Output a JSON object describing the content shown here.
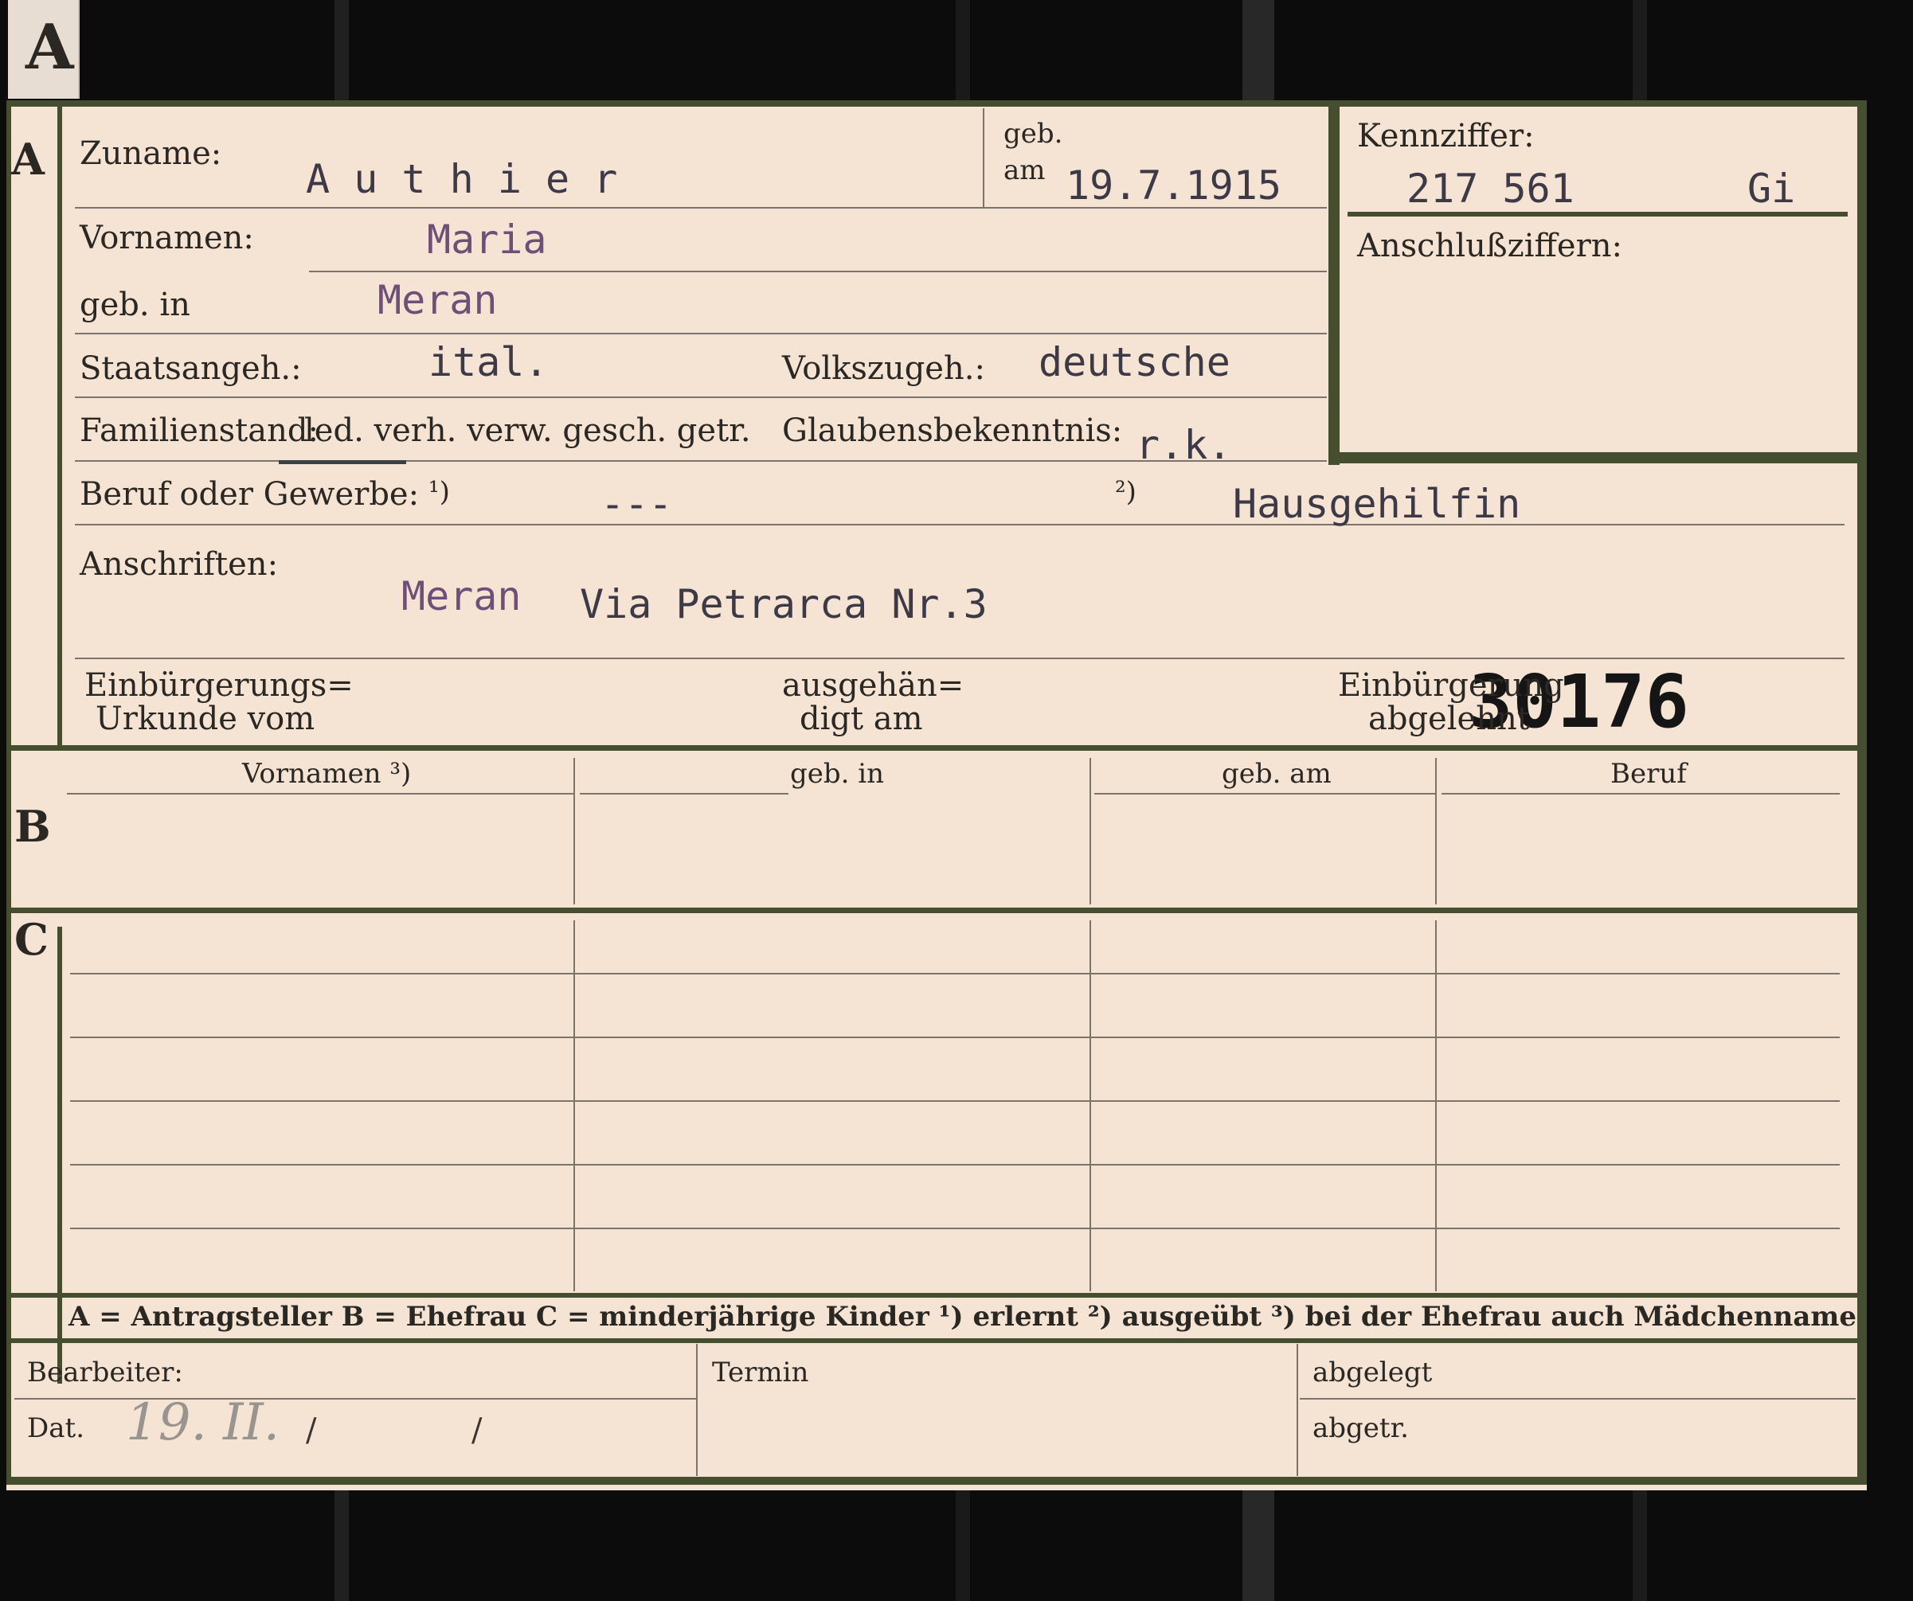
{
  "tab_letter": "A",
  "section_a": {
    "letter": "A",
    "surname_label": "Zuname:",
    "surname_value": "A u t h i e r",
    "geb_label": "geb.",
    "am_label": "am",
    "birth_date": "19.7.1915",
    "vornamen_label": "Vornamen:",
    "vornamen_value": "Maria",
    "geb_in_label": "geb. in",
    "geb_in_value": "Meran",
    "staatsangeh_label": "Staatsangeh.:",
    "staatsangeh_value": "ital.",
    "volkszugeh_label": "Volkszugeh.:",
    "volkszugeh_value": "deutsche",
    "familienstand_label": "Familienstand:",
    "familienstand_options": "led. verh. verw. gesch. getr.",
    "glaubens_label": "Glaubensbekenntnis:",
    "glaubens_value": "r.k.",
    "beruf_label": "Beruf oder Gewerbe:",
    "beruf_mark1": "¹)",
    "beruf_value1": "---",
    "beruf_mark2": "²)",
    "beruf_value2": "Hausgehilfin",
    "anschriften_label": "Anschriften:",
    "address_city": "Meran",
    "address_street": "Via Petrarca  Nr.3",
    "stamp_number": "30176",
    "einb_urkunde_l1": "Einbürgerungs=",
    "einb_urkunde_l2": "Urkunde vom",
    "ausgehaen_l1": "ausgehän=",
    "ausgehaen_l2": "digt am",
    "einb_abgelehnt_l1": "Einbürgerung",
    "einb_abgelehnt_l2": "abgelehnt"
  },
  "kennziffer": {
    "label": "Kennziffer:",
    "number": "217 561",
    "suffix": "Gi",
    "anschluss_label": "Anschlußziffern:"
  },
  "section_b": {
    "letter": "B",
    "columns": [
      "Vornamen ³)",
      "geb. in",
      "geb. am",
      "Beruf"
    ]
  },
  "section_c": {
    "letter": "C"
  },
  "legend": "A = Antragsteller   B = Ehefrau   C = minderjährige Kinder   ¹) erlernt   ²) ausgeübt   ³) bei der Ehefrau auch Mädchenname",
  "footer": {
    "bearbeiter_label": "Bearbeiter:",
    "dat_label": "Dat.",
    "dat_value": "19. II.",
    "slash1": "/",
    "slash2": "/",
    "termin_label": "Termin",
    "abgelegt_label": "abgelegt",
    "abgetr_label": "abgetr."
  },
  "colors": {
    "card": "#f5e3d4",
    "rule_green": "#454f2f",
    "type_ink": "#3d3946",
    "purple_ink": "#6f4f77",
    "stamp_ink": "#151515"
  }
}
